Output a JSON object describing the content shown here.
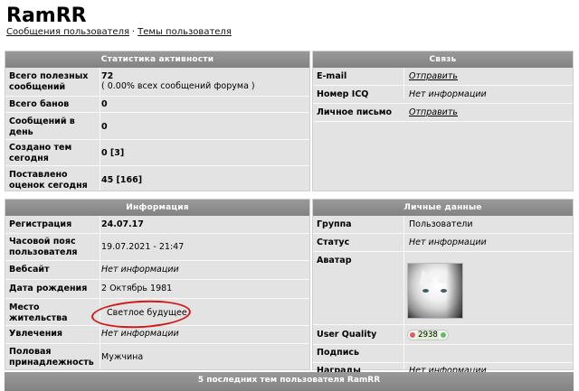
{
  "profile": {
    "username": "RamRR",
    "links": [
      "Сообщения пользователя",
      "Темы пользователя"
    ],
    "separator": "·"
  },
  "stats": {
    "title": "Статистика активности",
    "rows": [
      {
        "label": "Всего полезных сообщений",
        "value": "72",
        "extra": "( 0.00% всех сообщений форума )"
      },
      {
        "label": "Всего банов",
        "value": "0"
      },
      {
        "label": "Сообщений в день",
        "value": "0"
      },
      {
        "label": "Создано тем сегодня",
        "value": "0 [3]"
      },
      {
        "label": "Поставлено оценок сегодня",
        "value": "45 [166]"
      }
    ]
  },
  "contact": {
    "title": "Связь",
    "rows": [
      {
        "label": "E-mail",
        "value": "Отправить"
      },
      {
        "label": "Номер ICQ",
        "value": "Нет информации"
      },
      {
        "label": "Личное письмо",
        "value": "Отправить"
      }
    ]
  },
  "info": {
    "title": "Информация",
    "rows": [
      {
        "label": "Регистрация",
        "value": "24.07.17"
      },
      {
        "label": "Часовой пояс пользователя",
        "value": "19.07.2021 - 21:47"
      },
      {
        "label": "Вебсайт",
        "value": "Нет информации"
      },
      {
        "label": "Дата рождения",
        "value": "2 Октябрь 1981"
      },
      {
        "label": "Место жительства",
        "value": "Светлое будущее"
      },
      {
        "label": "Увлечения",
        "value": "Нет информации"
      },
      {
        "label": "Половая принадлежность",
        "value": "Мужчина"
      }
    ]
  },
  "personal": {
    "title": "Личные данные",
    "rows": [
      {
        "label": "Группа",
        "value": "Пользователи"
      },
      {
        "label": "Статус",
        "value": "Нет информации"
      },
      {
        "label": "Аватар",
        "value": ""
      },
      {
        "label": "User Quality",
        "value": "2938"
      },
      {
        "label": "Подпись",
        "value": ""
      },
      {
        "label": "Награды",
        "value": "Нет информации"
      }
    ]
  },
  "recent": {
    "title": "5 последних тем пользователя RamRR"
  },
  "colors": {
    "header_bg": "#8c8c8c",
    "panel_bg": "#e3e3e3",
    "annotation_red": "#d11a1a"
  }
}
